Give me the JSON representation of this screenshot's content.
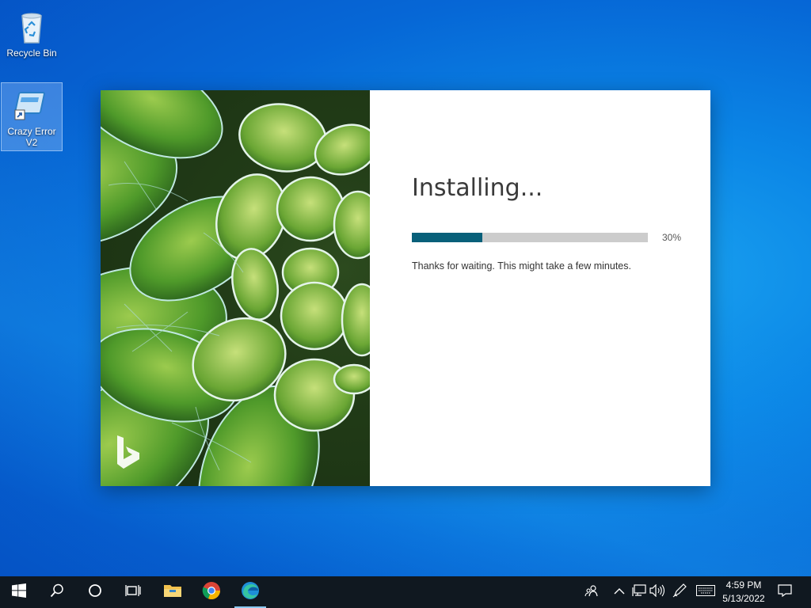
{
  "desktop": {
    "icons": [
      {
        "label": "Recycle Bin",
        "icon": "recycle-bin-icon"
      },
      {
        "label": "Crazy Error V2",
        "icon": "shortcut-app-icon"
      }
    ]
  },
  "installer": {
    "title": "Installing...",
    "progress": {
      "percent_label": "30%",
      "fraction": 0.3
    },
    "message": "Thanks for waiting. This might take a few minutes.",
    "brand_icon": "bing-logo-icon",
    "colors": {
      "progress_fill": "#08607a",
      "progress_track": "#cccccc"
    }
  },
  "taskbar": {
    "buttons": [
      {
        "name": "start",
        "icon": "windows-logo-icon"
      },
      {
        "name": "search",
        "icon": "search-icon"
      },
      {
        "name": "cortana",
        "icon": "cortana-ring-icon"
      },
      {
        "name": "task-view",
        "icon": "task-view-icon"
      },
      {
        "name": "file-explorer",
        "icon": "folder-icon"
      },
      {
        "name": "chrome",
        "icon": "chrome-icon"
      },
      {
        "name": "edge",
        "icon": "edge-icon"
      }
    ],
    "tray": [
      {
        "name": "people",
        "icon": "people-icon"
      },
      {
        "name": "show-hidden",
        "icon": "chevron-up-icon"
      },
      {
        "name": "network",
        "icon": "network-icon"
      },
      {
        "name": "volume",
        "icon": "volume-icon"
      },
      {
        "name": "pen",
        "icon": "pen-icon"
      },
      {
        "name": "keyboard",
        "icon": "keyboard-icon"
      }
    ],
    "clock": {
      "time": "4:59 PM",
      "date": "5/13/2022"
    },
    "notification_icon": "action-center-icon"
  }
}
